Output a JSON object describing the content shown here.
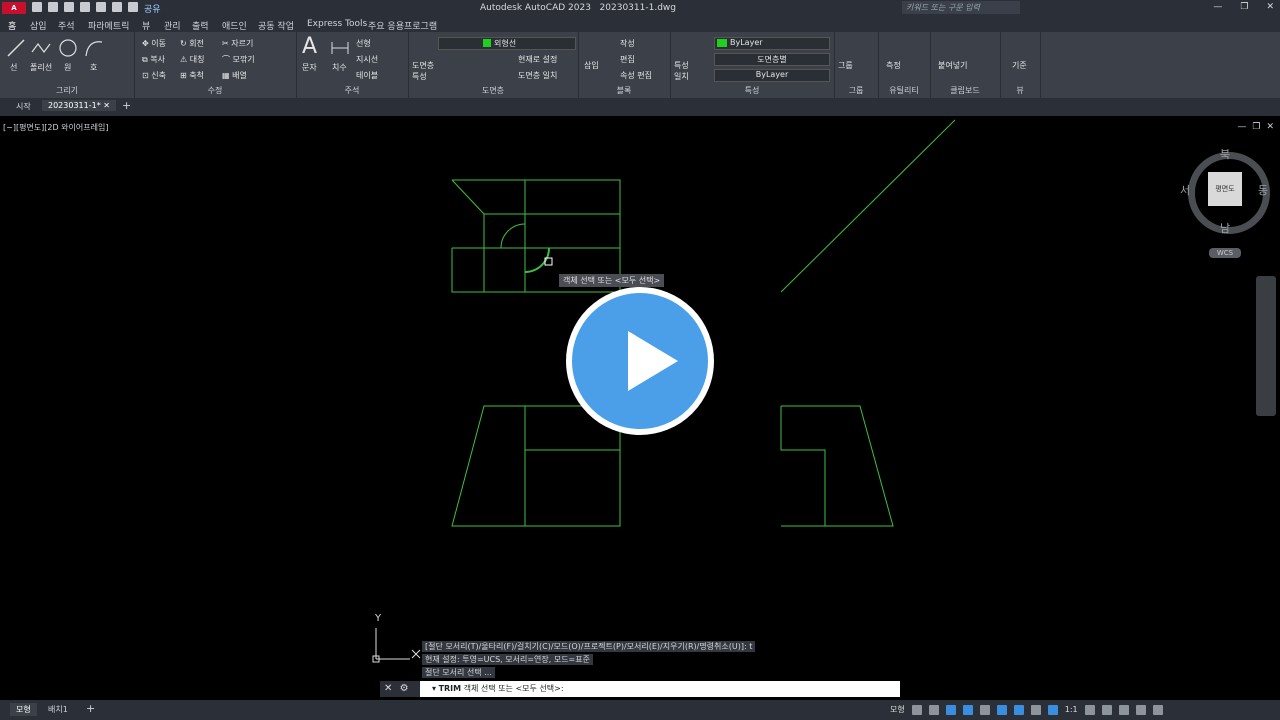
{
  "app": {
    "logo": "A CAD",
    "title": "Autodesk AutoCAD 2023",
    "filename": "20230311-1.dwg",
    "search_placeholder": "키워드 또는 구문 입력",
    "share_label": "공유"
  },
  "menu_tabs": [
    "홈",
    "삽입",
    "주석",
    "파라메트릭",
    "뷰",
    "관리",
    "출력",
    "애드인",
    "공동 작업",
    "Express Tools",
    "주요 응용프로그램"
  ],
  "ribbon": {
    "draw": {
      "title": "그리기",
      "line": "선",
      "polyline": "폴리선",
      "circle": "원",
      "arc": "호"
    },
    "modify": {
      "title": "수정",
      "move": "이동",
      "rotate": "회전",
      "trim": "자르기",
      "copy": "복사",
      "mirror": "대칭",
      "fillet": "모깎기",
      "stretch": "신축",
      "scale": "축척",
      "array": "배열"
    },
    "annotation": {
      "title": "주석",
      "text": "문자",
      "dimension": "치수",
      "linear": "선형",
      "leader": "지시선",
      "table": "테이블"
    },
    "layers": {
      "title": "도면층",
      "layer_props": "도면층 특성",
      "current_layer": "외형선",
      "make_current": "현재로 설정",
      "match_layer": "도면층 일치"
    },
    "block": {
      "title": "블록",
      "insert": "삽입",
      "create": "작성",
      "edit": "편집",
      "edit_attr": "속성 편집"
    },
    "properties": {
      "title": "특성",
      "match": "특성 일치",
      "color": "ByLayer",
      "linetype": "도면층별",
      "lineweight": "ByLayer"
    },
    "groups": {
      "title": "그룹",
      "group": "그룹"
    },
    "utilities": {
      "title": "유틸리티",
      "measure": "측정"
    },
    "clipboard": {
      "title": "클립보드",
      "paste": "붙여넣기"
    },
    "view": {
      "title": "뷰",
      "base": "기준"
    }
  },
  "doc_tabs": {
    "start": "시작",
    "active": "20230311-1*"
  },
  "viewport": {
    "label": "[−][평면도][2D 와이어프레임]",
    "tooltip": "객체 선택 또는 <모두 선택>",
    "viewcube": {
      "north": "북",
      "south": "남",
      "west": "서",
      "east": "동",
      "face": "평면도"
    },
    "wcs": "WCS"
  },
  "command": {
    "history": [
      "[절단 모서리(T)/울타리(F)/걸치기(C)/모드(O)/프로젝트(P)/모서리(E)/지우기(R)/명령취소(U)]: t",
      "현재 설정: 투영=UCS, 모서리=연장, 모드=표준",
      "절단 모서리 선택 ..."
    ],
    "prompt_cmd": "TRIM",
    "prompt_text": "객체 선택 또는 <모두 선택>:"
  },
  "status": {
    "model_tab": "모형",
    "layout_tab": "배치1",
    "model_label": "모형",
    "scale": "1:1"
  },
  "colors": {
    "drawing_line": "#3fbf3f",
    "background": "#000000",
    "play_button": "#4a9fe8"
  }
}
